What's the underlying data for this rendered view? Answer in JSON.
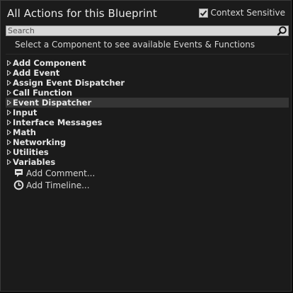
{
  "window": {
    "title": "All Actions for this Blueprint"
  },
  "context_sensitive": {
    "label": "Context Sensitive",
    "checked": true
  },
  "search": {
    "placeholder": "Search",
    "value": ""
  },
  "hint": "Select a Component to see available Events & Functions",
  "categories": [
    {
      "label": "Add Component"
    },
    {
      "label": "Add Event"
    },
    {
      "label": "Assign Event Dispatcher"
    },
    {
      "label": "Call Function"
    },
    {
      "label": "Event Dispatcher",
      "selected": true
    },
    {
      "label": "Input"
    },
    {
      "label": "Interface Messages"
    },
    {
      "label": "Math"
    },
    {
      "label": "Networking"
    },
    {
      "label": "Utilities"
    },
    {
      "label": "Variables"
    }
  ],
  "actions": [
    {
      "label": "Add Comment...",
      "icon": "comment-icon"
    },
    {
      "label": "Add Timeline...",
      "icon": "clock-icon"
    }
  ]
}
